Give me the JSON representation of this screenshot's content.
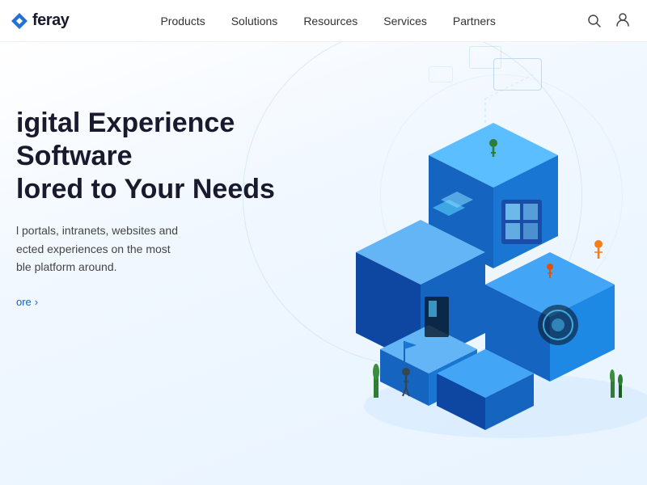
{
  "header": {
    "logo_text": "feray",
    "nav_items": [
      {
        "label": "Products",
        "id": "products"
      },
      {
        "label": "Solutions",
        "id": "solutions"
      },
      {
        "label": "Resources",
        "id": "resources"
      },
      {
        "label": "Services",
        "id": "services"
      },
      {
        "label": "Partners",
        "id": "partners"
      }
    ],
    "actions": {
      "search_label": "Search",
      "sign_in_label": "S"
    }
  },
  "hero": {
    "title": "igital Experience Software\nlored to Your Needs",
    "title_full": "Digital Experience Software Tailored to Your Needs",
    "subtitle": "l portals, intranets, websites and\nected experiences on the most\nble platform around.",
    "subtitle_full": "Build portals, intranets, websites and connected experiences on the most flexible platform around.",
    "cta_label": "ore",
    "cta_arrow": "›"
  }
}
